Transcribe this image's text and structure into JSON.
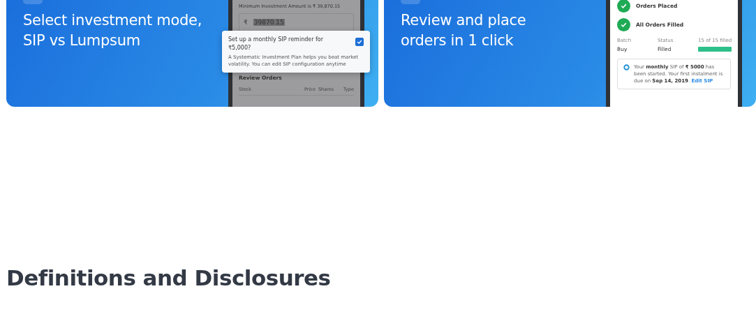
{
  "cards": [
    {
      "kind": "sip",
      "title": [
        "Select investment mode,",
        "SIP vs Lumpsum"
      ],
      "phone": {
        "min_amount": "Minimum Investment Amount is ₹ 39,870.15",
        "currency": "₹",
        "amount": "39870.15",
        "section": "Review Orders",
        "columns": [
          "Stock",
          "Price",
          "Shares",
          "Type"
        ]
      },
      "popup": {
        "question": "Set up a monthly SIP reminder for ₹5,000?",
        "checked": true,
        "description": "A Systematic Investment Plan helps you beat market volatility. You can edit SIP configuration anytime"
      }
    },
    {
      "kind": "orders",
      "title": [
        "Review and place",
        "orders in 1 click"
      ],
      "phone": {
        "steps": [
          {
            "label": "Orders Placed",
            "done": true
          },
          {
            "label": "All Orders Filled",
            "done": true
          }
        ],
        "headers": [
          "Batch",
          "Status",
          "15 of 15 filled"
        ],
        "values": [
          "Buy",
          "Filled"
        ],
        "level": 1,
        "notice": "Your **monthly** SIP of **₹ 5000** has been started. Your first instalment is due on **Sep 14, 2019**.",
        "link": "Edit SIP"
      }
    }
  ],
  "heading": "Definitions and Disclosures"
}
